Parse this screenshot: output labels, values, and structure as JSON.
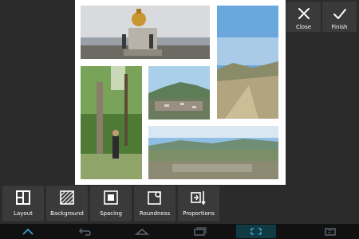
{
  "top_actions": {
    "close_label": "Close",
    "finish_label": "Finish"
  },
  "collage": {
    "photos": [
      {
        "name": "monument-photo"
      },
      {
        "name": "mountain-plain-photo"
      },
      {
        "name": "forest-person-photo"
      },
      {
        "name": "valley-town-photo"
      },
      {
        "name": "wide-landscape-photo"
      }
    ]
  },
  "toolbar": {
    "items": [
      {
        "label": "Layout",
        "icon": "layout-icon"
      },
      {
        "label": "Background",
        "icon": "background-icon"
      },
      {
        "label": "Spacing",
        "icon": "spacing-icon"
      },
      {
        "label": "Roundness",
        "icon": "roundness-icon"
      },
      {
        "label": "Proportions",
        "icon": "proportions-icon"
      }
    ]
  },
  "navbar": {
    "items": [
      {
        "icon": "home-icon"
      },
      {
        "icon": "back-icon"
      },
      {
        "icon": "home-outline-icon"
      },
      {
        "icon": "recent-apps-icon"
      },
      {
        "icon": "screenshot-icon"
      },
      {
        "icon": "menu-icon"
      }
    ]
  },
  "colors": {
    "background": "#2b2b2b",
    "button": "#3a3a3a",
    "navbar": "#111111",
    "nav_accent": "#3aa9d0"
  }
}
